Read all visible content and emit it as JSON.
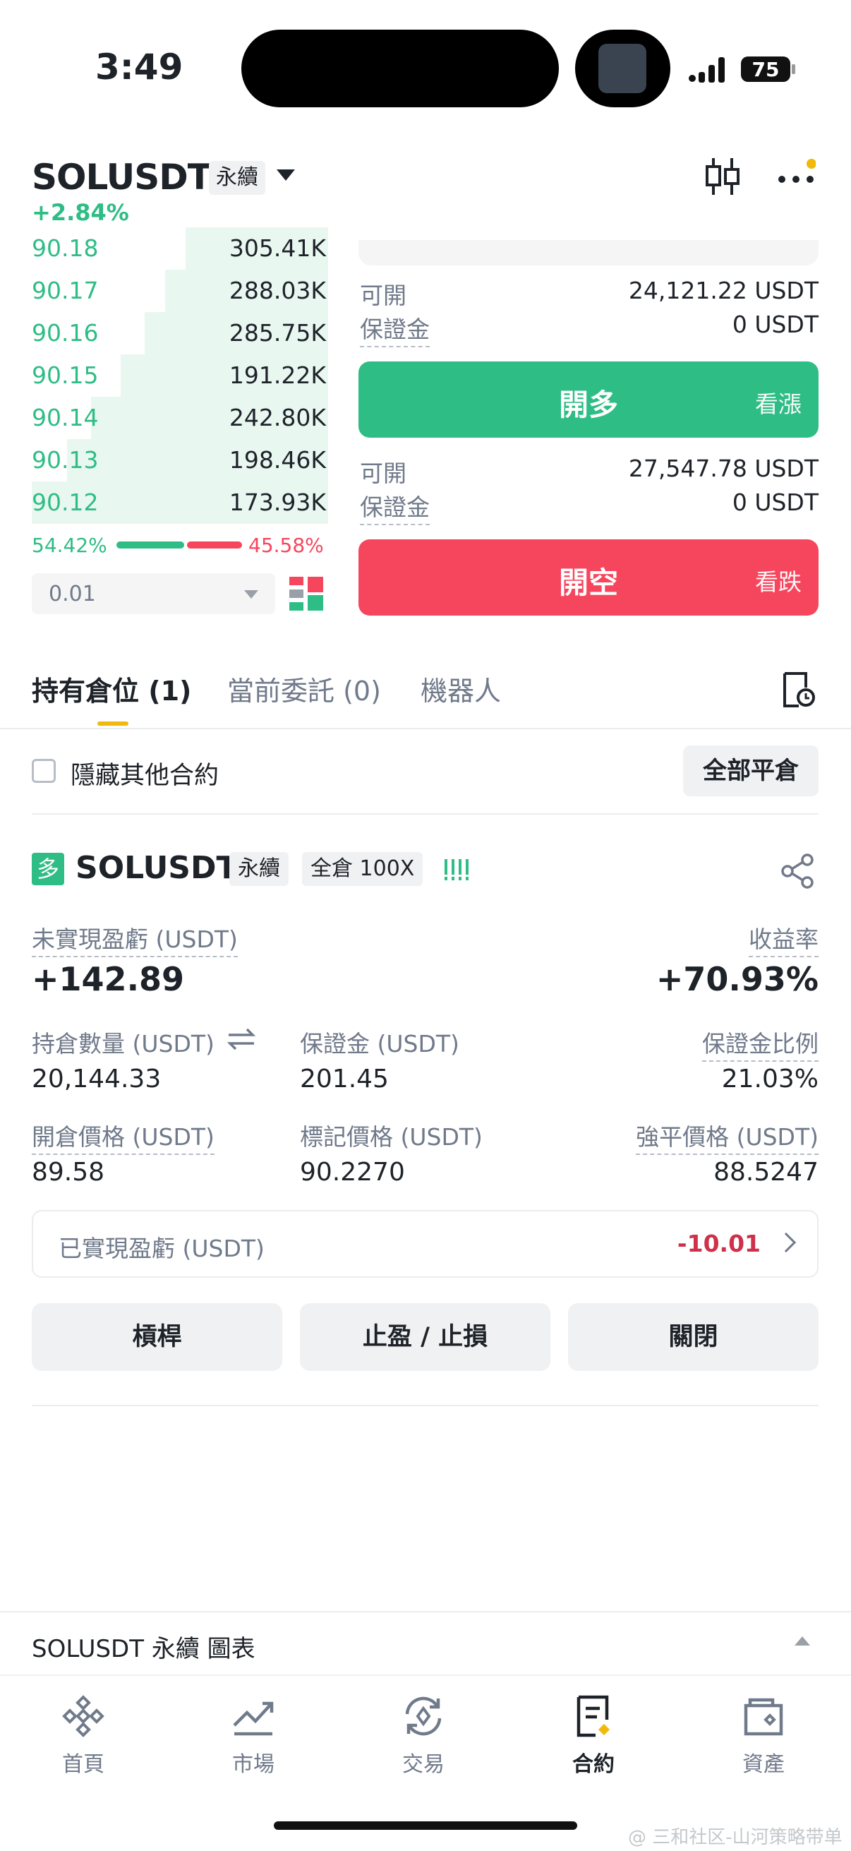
{
  "status_bar": {
    "time": "3:49",
    "battery": "75"
  },
  "header": {
    "symbol": "SOLUSDT",
    "contract_type": "永續",
    "change": "+2.84%"
  },
  "order_book": {
    "rows": [
      {
        "price": "90.18",
        "qty": "305.41K",
        "depth": 0.48
      },
      {
        "price": "90.17",
        "qty": "288.03K",
        "depth": 0.55
      },
      {
        "price": "90.16",
        "qty": "285.75K",
        "depth": 0.62
      },
      {
        "price": "90.15",
        "qty": "191.22K",
        "depth": 0.7
      },
      {
        "price": "90.14",
        "qty": "242.80K",
        "depth": 0.8
      },
      {
        "price": "90.13",
        "qty": "198.46K",
        "depth": 0.88
      },
      {
        "price": "90.12",
        "qty": "173.93K",
        "depth": 1.0
      }
    ],
    "buy_ratio": "54.42%",
    "sell_ratio": "45.58%",
    "precision": "0.01"
  },
  "order_form": {
    "long": {
      "available_label": "可開",
      "available_value": "24,121.22 USDT",
      "margin_label": "保證金",
      "margin_value": "0 USDT",
      "button": "開多",
      "hint": "看漲"
    },
    "short": {
      "available_label": "可開",
      "available_value": "27,547.78 USDT",
      "margin_label": "保證金",
      "margin_value": "0 USDT",
      "button": "開空",
      "hint": "看跌"
    }
  },
  "tabs": [
    {
      "label": "持有倉位 (1)"
    },
    {
      "label": "當前委託 (0)"
    },
    {
      "label": "機器人"
    }
  ],
  "filter": {
    "hide_label": "隱藏其他合約",
    "close_all": "全部平倉"
  },
  "position": {
    "side_badge": "多",
    "symbol": "SOLUSDT",
    "contract_type": "永續",
    "margin_mode": "全倉 100X",
    "unrealized_label": "未實現盈虧 (USDT)",
    "unrealized_value": "+142.89",
    "roe_label": "收益率",
    "roe_value": "+70.93%",
    "size_label": "持倉數量 (USDT)",
    "size_value": "20,144.33",
    "margin_label": "保證金 (USDT)",
    "margin_value": "201.45",
    "margin_ratio_label": "保證金比例",
    "margin_ratio_value": "21.03%",
    "entry_label": "開倉價格 (USDT)",
    "entry_value": "89.58",
    "mark_label": "標記價格 (USDT)",
    "mark_value": "90.2270",
    "liq_label": "強平價格 (USDT)",
    "liq_value": "88.5247",
    "realized_label": "已實現盈虧 (USDT)",
    "realized_value": "-10.01",
    "buttons": {
      "leverage": "槓桿",
      "tpsl": "止盈 / 止損",
      "close": "關閉"
    }
  },
  "chart_bar": {
    "label": "SOLUSDT 永續 圖表"
  },
  "bottom_nav": [
    {
      "label": "首頁",
      "icon": "home-icon"
    },
    {
      "label": "市場",
      "icon": "markets-icon"
    },
    {
      "label": "交易",
      "icon": "trade-icon"
    },
    {
      "label": "合約",
      "icon": "futures-icon"
    },
    {
      "label": "資產",
      "icon": "wallet-icon"
    }
  ],
  "watermark": "@ 三和社区-山河策略带单",
  "colors": {
    "up": "#2ebd85",
    "down": "#f6465d",
    "accent": "#f0b90b"
  }
}
